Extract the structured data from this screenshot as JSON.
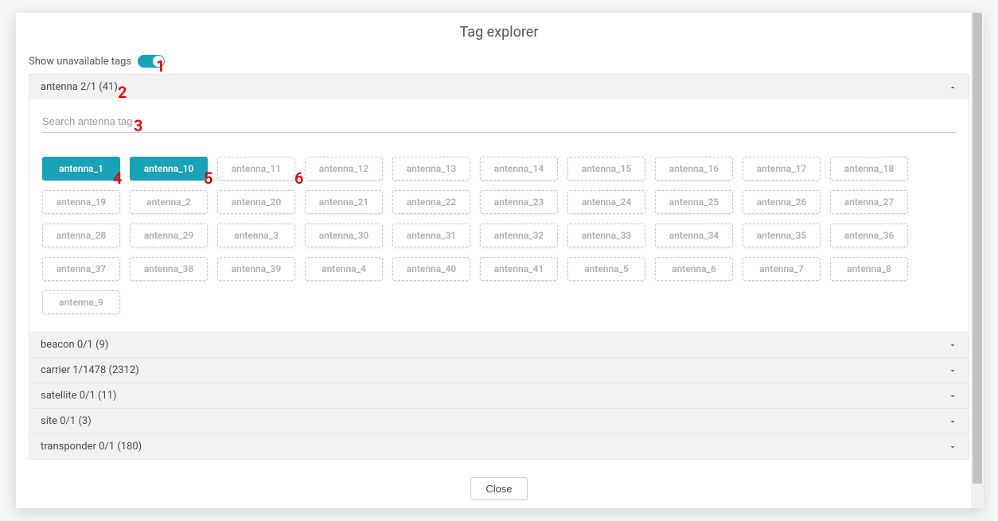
{
  "annotations": {
    "a1": "1",
    "a2": "2",
    "a3": "3",
    "a4": "4",
    "a5": "5",
    "a6": "6"
  },
  "modal": {
    "title": "Tag explorer",
    "toggle_label": "Show unavailable tags",
    "close_label": "Close",
    "search_placeholder": "Search antenna tag"
  },
  "sections": {
    "antenna": {
      "header": "antenna 2/1 (41)"
    },
    "beacon": {
      "header": "beacon 0/1 (9)"
    },
    "carrier": {
      "header": "carrier 1/1478 (2312)"
    },
    "satellite": {
      "header": "satellite 0/1 (11)"
    },
    "site": {
      "header": "site 0/1 (3)"
    },
    "transponder": {
      "header": "transponder 0/1 (180)"
    }
  },
  "tags": {
    "t0": "antenna_1",
    "t1": "antenna_10",
    "t2": "antenna_11",
    "t3": "antenna_12",
    "t4": "antenna_13",
    "t5": "antenna_14",
    "t6": "antenna_15",
    "t7": "antenna_16",
    "t8": "antenna_17",
    "t9": "antenna_18",
    "t10": "antenna_19",
    "t11": "antenna_2",
    "t12": "antenna_20",
    "t13": "antenna_21",
    "t14": "antenna_22",
    "t15": "antenna_23",
    "t16": "antenna_24",
    "t17": "antenna_25",
    "t18": "antenna_26",
    "t19": "antenna_27",
    "t20": "antenna_28",
    "t21": "antenna_29",
    "t22": "antenna_3",
    "t23": "antenna_30",
    "t24": "antenna_31",
    "t25": "antenna_32",
    "t26": "antenna_33",
    "t27": "antenna_34",
    "t28": "antenna_35",
    "t29": "antenna_36",
    "t30": "antenna_37",
    "t31": "antenna_38",
    "t32": "antenna_39",
    "t33": "antenna_4",
    "t34": "antenna_40",
    "t35": "antenna_41",
    "t36": "antenna_5",
    "t37": "antenna_6",
    "t38": "antenna_7",
    "t39": "antenna_8",
    "t40": "antenna_9"
  }
}
